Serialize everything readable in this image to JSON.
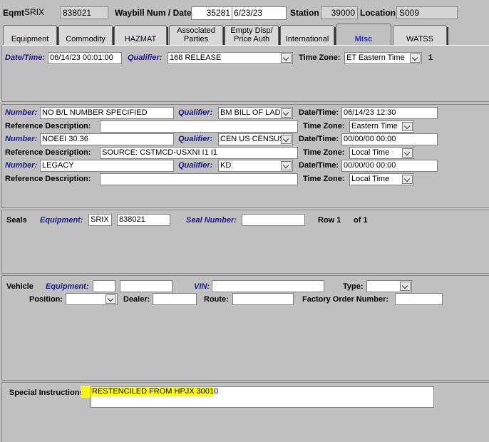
{
  "header": {
    "eqmt_label": "Eqmt",
    "eqmt_initial": "SRIX",
    "eqmt_number": "838021",
    "waybill_label": "Waybill Num / Date",
    "waybill_num": "35281",
    "waybill_date": "6/23/23",
    "station_label": "Station",
    "station_value": "39000",
    "location_label": "Location",
    "location_value": "S009"
  },
  "tabs": [
    {
      "label": "Equipment"
    },
    {
      "label": "Commodity"
    },
    {
      "label": "HAZMAT"
    },
    {
      "label": "Associated Parties"
    },
    {
      "label": "Empty Disp/ Price Auth"
    },
    {
      "label": "International"
    },
    {
      "label": "Misc",
      "active": true
    },
    {
      "label": "WATSS"
    }
  ],
  "datetime_panel": {
    "datetime_label": "Date/Time:",
    "datetime_value": "06/14/23 00:01:00",
    "qualifier_label": "Qualifier:",
    "qualifier_value": "168 RELEASE",
    "timezone_label": "Time Zone:",
    "timezone_value": "ET Eastern Time",
    "count": "1"
  },
  "references": {
    "rows": [
      {
        "number_label": "Number:",
        "number_value": "NO B/L NUMBER SPECIFIED",
        "qualifier_label": "Qualifier:",
        "qualifier_value": "BM BILL OF LADIN",
        "datetime_label": "Date/Time:",
        "datetime_value": "06/14/23 12:30",
        "refdesc_label": "Reference Description:",
        "refdesc_value": "",
        "timezone_label": "Time Zone:",
        "timezone_value": "Eastern Time"
      },
      {
        "number_label": "Number:",
        "number_value": "NOEEI 30.36",
        "qualifier_label": "Qualifier:",
        "qualifier_value": "CEN US CENSUS E",
        "datetime_label": "Date/Time:",
        "datetime_value": "00/00/00 00:00",
        "refdesc_label": "Reference Description:",
        "refdesc_value": "SOURCE: CSTMCD-USXNI I1 I1",
        "timezone_label": "Time Zone:",
        "timezone_value": "Local Time"
      },
      {
        "number_label": "Number:",
        "number_value": "LEGACY",
        "qualifier_label": "Qualifier:",
        "qualifier_value": "KD",
        "datetime_label": "Date/Time:",
        "datetime_value": "00/00/00 00:00",
        "refdesc_label": "Reference Description:",
        "refdesc_value": "",
        "timezone_label": "Time Zone:",
        "timezone_value": "Local Time"
      }
    ]
  },
  "seals": {
    "title": "Seals",
    "equipment_label": "Equipment:",
    "equipment_initial": "SRIX",
    "equipment_number": "838021",
    "seal_number_label": "Seal Number:",
    "seal_number_value": "",
    "row_label": "Row 1",
    "of_label": "of 1"
  },
  "vehicle": {
    "title": "Vehicle",
    "equipment_label": "Equipment:",
    "equipment_initial": "",
    "equipment_number": "",
    "vin_label": "VIN:",
    "vin_value": "",
    "type_label": "Type:",
    "type_value": "",
    "position_label": "Position:",
    "position_value": "",
    "dealer_label": "Dealer:",
    "dealer_value": "",
    "route_label": "Route:",
    "route_value": "",
    "factory_label": "Factory Order Number:",
    "factory_value": ""
  },
  "special": {
    "label": "Special Instructions:",
    "value": "RESTENCILED FROM HPJX 30010",
    "highlight_color": "#ffff00"
  }
}
